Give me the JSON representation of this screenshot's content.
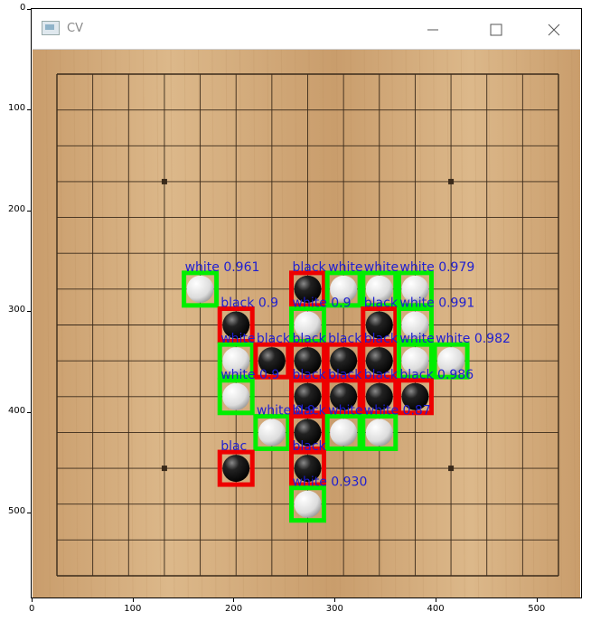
{
  "window": {
    "title": "CV",
    "minimize_label": "—",
    "maximize_label": "☐",
    "close_label": "✕"
  },
  "axes": {
    "x_ticks": [
      "0",
      "100",
      "200",
      "300",
      "400",
      "500"
    ],
    "y_ticks": [
      "0",
      "100",
      "200",
      "300",
      "400",
      "500"
    ]
  },
  "board": {
    "grid_lines": 15,
    "star_points": [
      [
        3,
        3
      ],
      [
        11,
        3
      ],
      [
        3,
        11
      ],
      [
        11,
        11
      ]
    ],
    "detections": [
      {
        "label": "white 0.961",
        "color": "white",
        "col": 4,
        "row": 6
      },
      {
        "label": "black",
        "color": "black",
        "col": 7,
        "row": 6
      },
      {
        "label": "white",
        "color": "white",
        "col": 8,
        "row": 6
      },
      {
        "label": "white",
        "color": "white",
        "col": 9,
        "row": 6
      },
      {
        "label": "white 0.979",
        "color": "white",
        "col": 10,
        "row": 6
      },
      {
        "label": "black 0.9",
        "color": "black",
        "col": 5,
        "row": 7
      },
      {
        "label": "white 0.9",
        "color": "white",
        "col": 7,
        "row": 7
      },
      {
        "label": "black",
        "color": "black",
        "col": 9,
        "row": 7
      },
      {
        "label": "white 0.991",
        "color": "white",
        "col": 10,
        "row": 7
      },
      {
        "label": "white",
        "color": "white",
        "col": 5,
        "row": 8
      },
      {
        "label": "black",
        "color": "black",
        "col": 6,
        "row": 8
      },
      {
        "label": "black",
        "color": "black",
        "col": 7,
        "row": 8
      },
      {
        "label": "black",
        "color": "black",
        "col": 8,
        "row": 8
      },
      {
        "label": "black",
        "color": "black",
        "col": 9,
        "row": 8
      },
      {
        "label": "white",
        "color": "white",
        "col": 10,
        "row": 8
      },
      {
        "label": "white 0.982",
        "color": "white",
        "col": 11,
        "row": 8
      },
      {
        "label": "white 0.9",
        "color": "white",
        "col": 5,
        "row": 9
      },
      {
        "label": "black",
        "color": "black",
        "col": 7,
        "row": 9
      },
      {
        "label": "black",
        "color": "black",
        "col": 8,
        "row": 9
      },
      {
        "label": "black",
        "color": "black",
        "col": 9,
        "row": 9
      },
      {
        "label": "black 0.986",
        "color": "black",
        "col": 10,
        "row": 9
      },
      {
        "label": "white 0.9",
        "color": "white",
        "col": 6,
        "row": 10
      },
      {
        "label": "black",
        "color": "black",
        "col": 7,
        "row": 10
      },
      {
        "label": "white",
        "color": "white",
        "col": 8,
        "row": 10
      },
      {
        "label": "white 0.87",
        "color": "white",
        "col": 9,
        "row": 10
      },
      {
        "label": "blac",
        "color": "black",
        "col": 5,
        "row": 11
      },
      {
        "label": "black",
        "color": "black",
        "col": 7,
        "row": 11
      },
      {
        "label": "white 0.930",
        "color": "white",
        "col": 7,
        "row": 12
      }
    ]
  },
  "colors": {
    "board_wood": "#dcb88a",
    "board_wood_dark": "#c99d6c",
    "grid_line": "#3a2a1a",
    "box_white": "#00ee00",
    "box_black": "#ee0000",
    "label_text": "#1f1fd0"
  }
}
